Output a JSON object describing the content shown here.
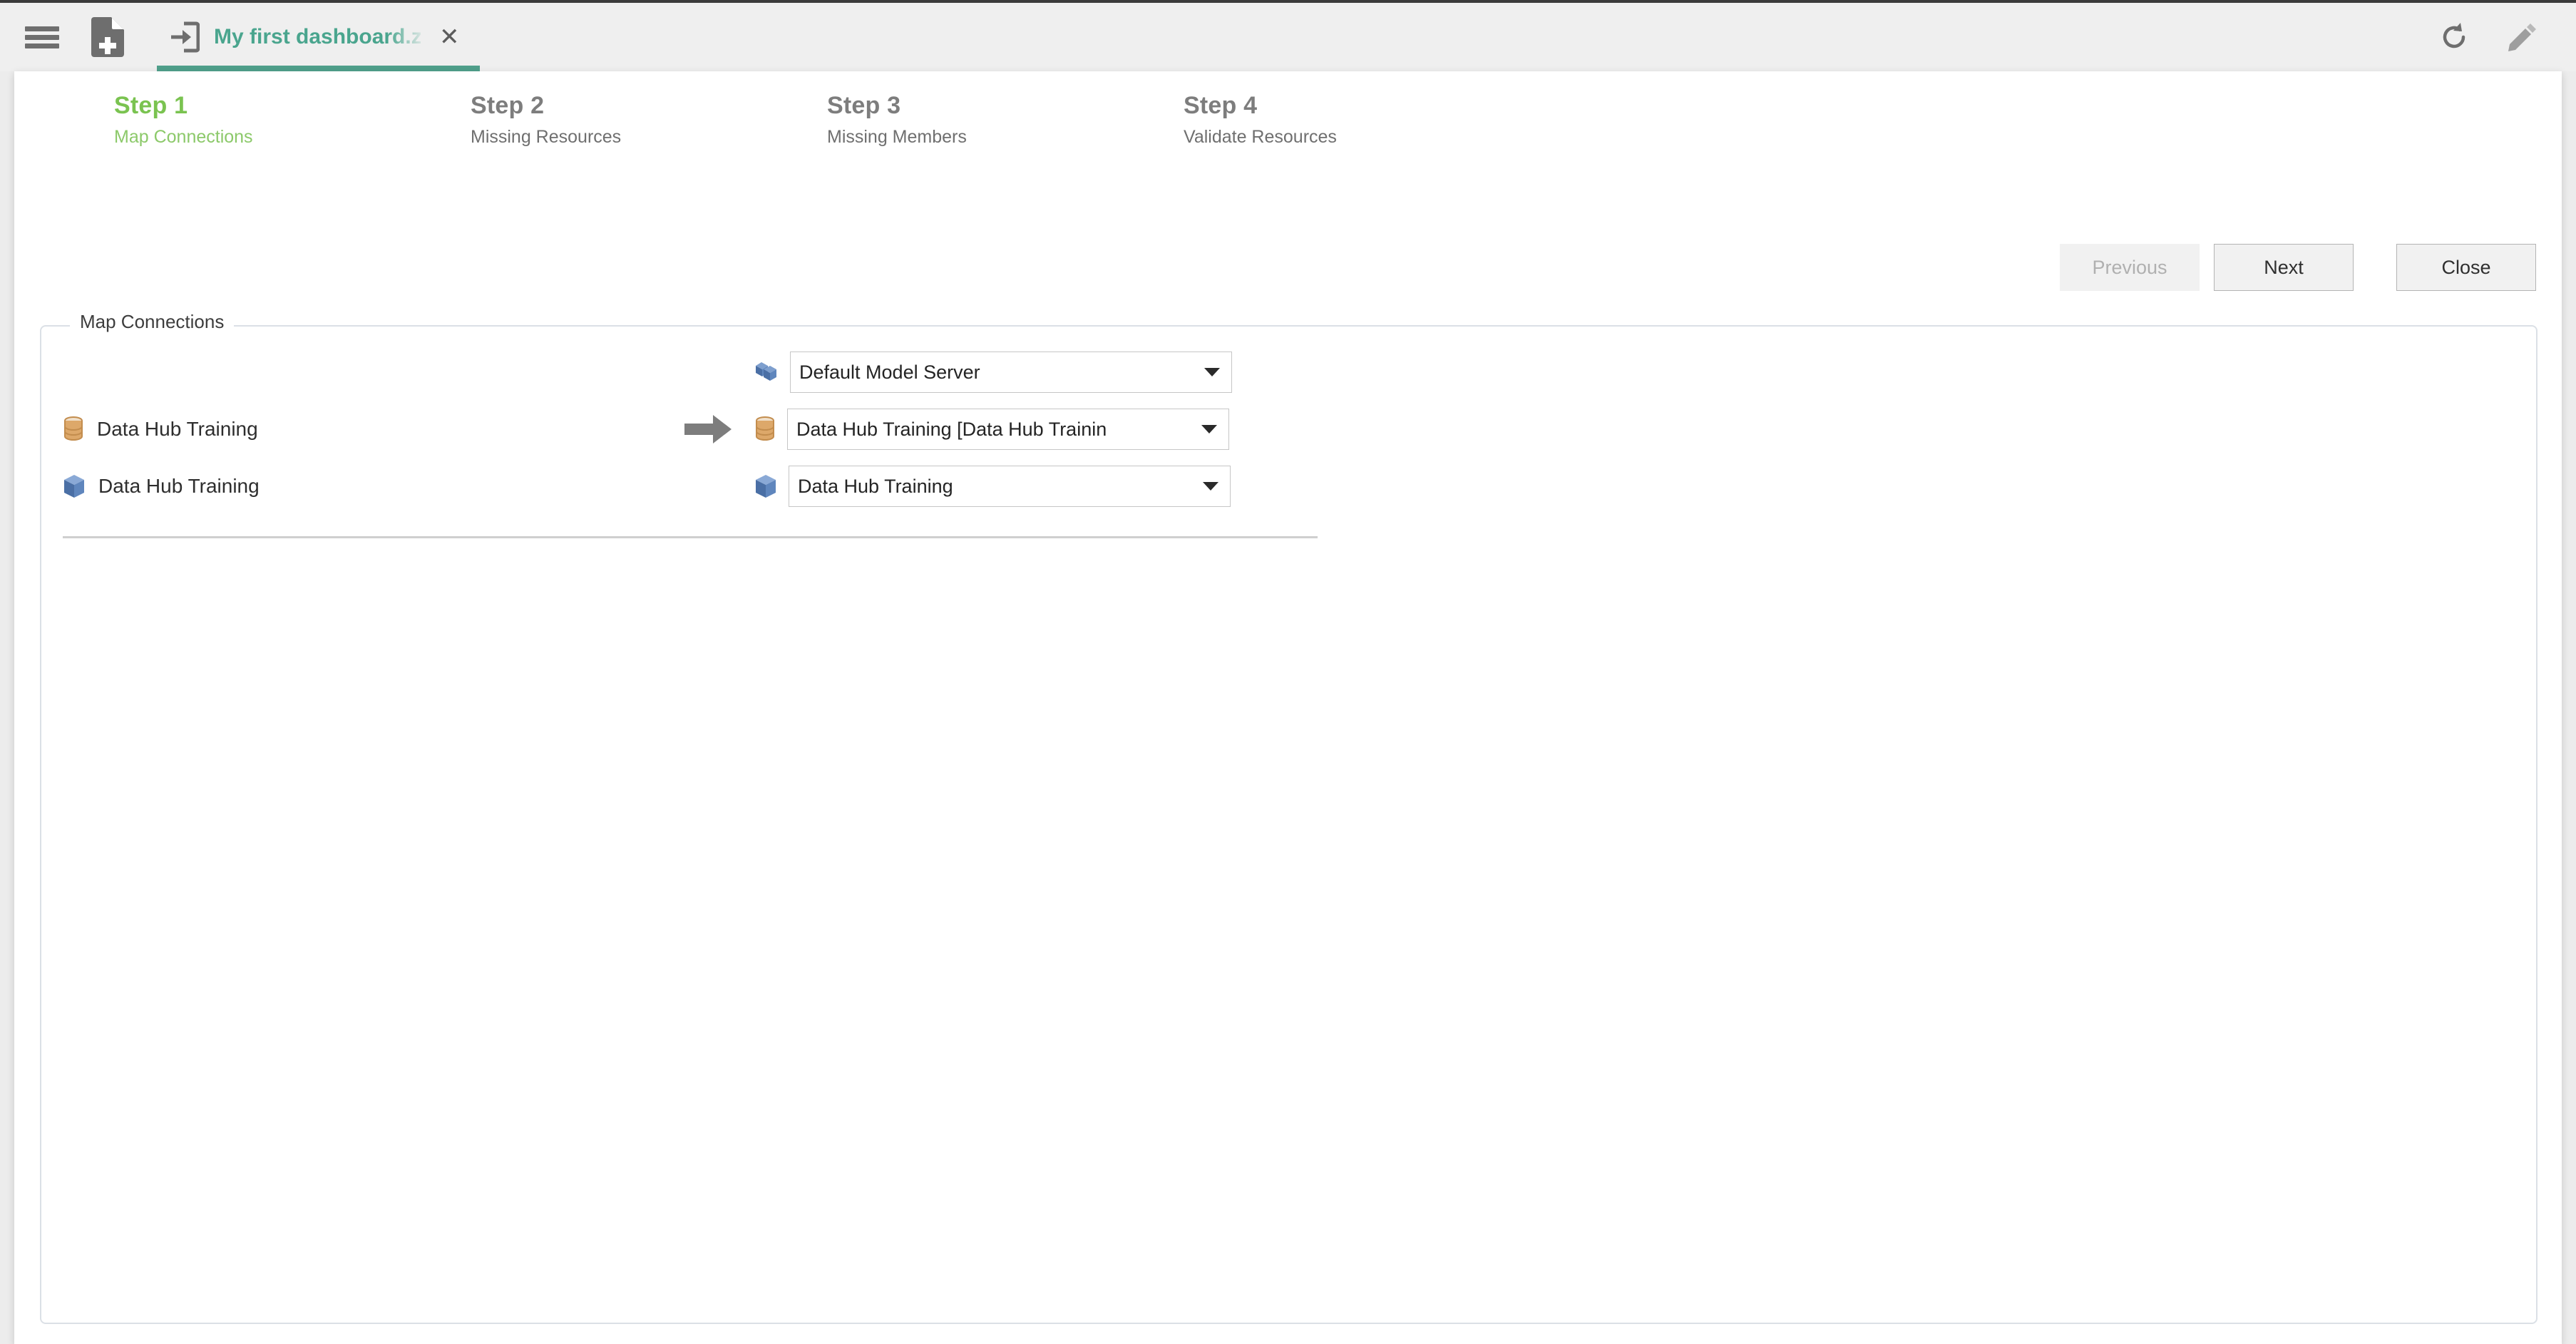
{
  "toolbar": {
    "menu_icon": "hamburger-menu-icon",
    "new_document_icon": "new-document-icon",
    "tab": {
      "icon": "import-arrow-icon",
      "title": "My first dashboard.za",
      "close_label": "✕",
      "active": true
    },
    "refresh_icon": "refresh-icon",
    "edit_icon": "pencil-edit-icon",
    "accent_color": "#4aa58e"
  },
  "wizard": {
    "steps": [
      {
        "number": "Step 1",
        "description": "Map Connections",
        "active": true
      },
      {
        "number": "Step 2",
        "description": "Missing Resources",
        "active": false
      },
      {
        "number": "Step 3",
        "description": "Missing Members",
        "active": false
      },
      {
        "number": "Step 4",
        "description": "Validate Resources",
        "active": false
      }
    ],
    "buttons": {
      "previous": "Previous",
      "next": "Next",
      "close": "Close"
    },
    "active_step_color": "#7ac350",
    "inactive_step_color": "#7d7d7d"
  },
  "group": {
    "legend": "Map Connections",
    "rows": [
      {
        "source_icon": "",
        "source_label": "",
        "arrow": false,
        "target_icon": "model-server-cubes-icon",
        "target_value": "Default Model Server"
      },
      {
        "source_icon": "database-cylinder-icon",
        "source_label": "Data Hub Training",
        "arrow": true,
        "target_icon": "database-cylinder-icon",
        "target_value": "Data Hub Training [Data Hub Trainin"
      },
      {
        "source_icon": "cube-icon",
        "source_label": "Data Hub Training",
        "arrow": false,
        "target_icon": "cube-icon",
        "target_value": "Data Hub Training"
      }
    ],
    "arrow_icon": "right-arrow-icon"
  }
}
